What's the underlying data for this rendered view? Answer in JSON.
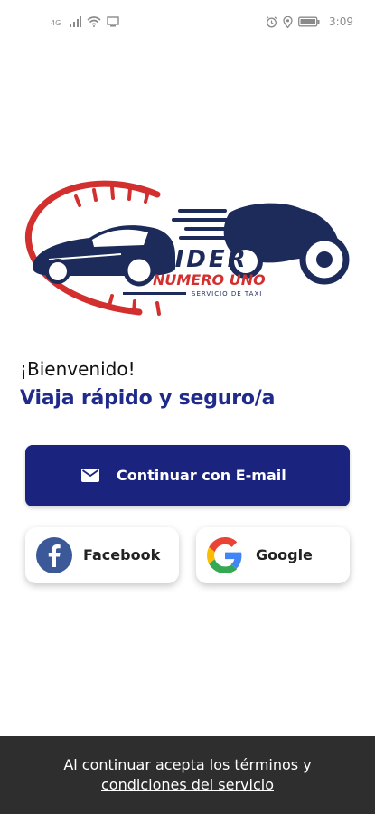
{
  "status_bar": {
    "time": "3:09",
    "left_icons": [
      "signal-icon",
      "signal-bars-icon",
      "wifi-icon",
      "screen-cast-icon"
    ],
    "right_icons": [
      "alarm-icon",
      "location-icon",
      "battery-icon"
    ]
  },
  "logo": {
    "brand_line1": "LIDER",
    "brand_line2": "NUMERO UNO",
    "subtitle": "SERVICIO DE TAXI",
    "colors": {
      "red": "#d32f2f",
      "navy": "#1c2b5a"
    }
  },
  "welcome": {
    "greeting": "¡Bienvenido!",
    "tagline": "Viaja rápido y seguro/a"
  },
  "email_button": {
    "label": "Continuar con E-mail",
    "icon": "mail-icon",
    "color": "#1a237e"
  },
  "social": {
    "facebook": {
      "label": "Facebook",
      "icon": "facebook-icon",
      "color": "#3b5998"
    },
    "google": {
      "label": "Google",
      "icon": "google-icon"
    }
  },
  "footer": {
    "terms_text": "Al continuar acepta los términos y condiciones del servicio",
    "background": "#2e2e2e"
  }
}
